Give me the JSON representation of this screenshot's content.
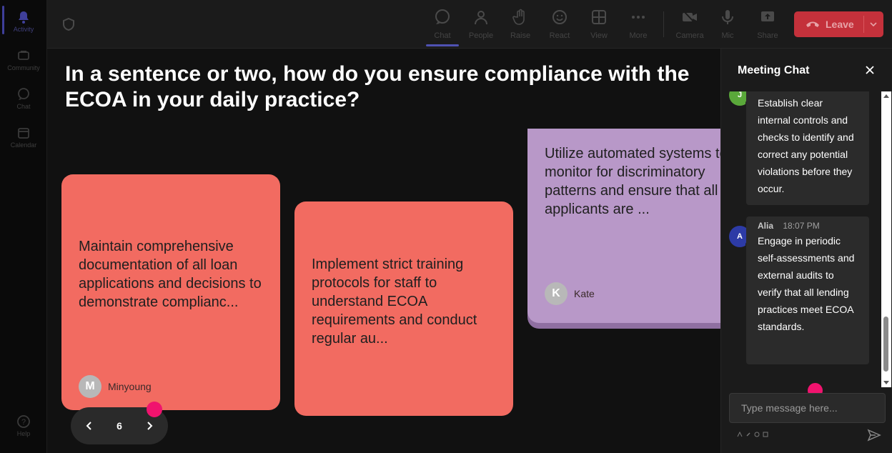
{
  "rail": {
    "items": [
      {
        "label": "Activity",
        "icon": "bell-icon",
        "active": true
      },
      {
        "label": "Community",
        "icon": "community-icon"
      },
      {
        "label": "Chat",
        "icon": "chat-icon"
      },
      {
        "label": "Calendar",
        "icon": "calendar-icon"
      },
      {
        "label": "Help",
        "icon": "help-icon"
      }
    ]
  },
  "toolbar": {
    "chat": "Chat",
    "people": "People",
    "raise": "Raise",
    "react": "React",
    "view": "View",
    "more": "More",
    "camera": "Camera",
    "mic": "Mic",
    "share": "Share",
    "leave": "Leave"
  },
  "stage": {
    "question": "In a sentence or two, how do you ensure compliance with the ECOA in your daily practice?",
    "cards": [
      {
        "text": "Maintain comprehensive documentation of all loan applications and decisions to demonstrate complianc...",
        "author": "Minyoung",
        "initial": "M",
        "color": "#f26b61"
      },
      {
        "text": "Implement strict training protocols for staff to understand ECOA requirements and conduct regular au...",
        "author": "",
        "initial": "",
        "color": "#f26b61"
      },
      {
        "text": "Utilize automated systems to monitor for discriminatory patterns and ensure that all applicants are ...",
        "author": "Kate",
        "initial": "K",
        "color": "#b898c8"
      }
    ],
    "pager": {
      "current": "6"
    }
  },
  "chat": {
    "title": "Meeting Chat",
    "messages": [
      {
        "initial": "J",
        "avatar_color": "#5aa83a",
        "name": "",
        "time": "",
        "body": "Establish clear internal controls and checks to identify and correct any potential violations before they occur."
      },
      {
        "initial": "A",
        "avatar_color": "#2d3ba6",
        "name": "Alia",
        "time": "18:07 PM",
        "body": "Engage in periodic self-assessments and external audits to verify that all lending practices meet ECOA standards."
      }
    ],
    "compose_placeholder": "Type message here..."
  },
  "colors": {
    "accent": "#4f52b2",
    "leave": "#c4313b",
    "marker": "#f0136e"
  }
}
